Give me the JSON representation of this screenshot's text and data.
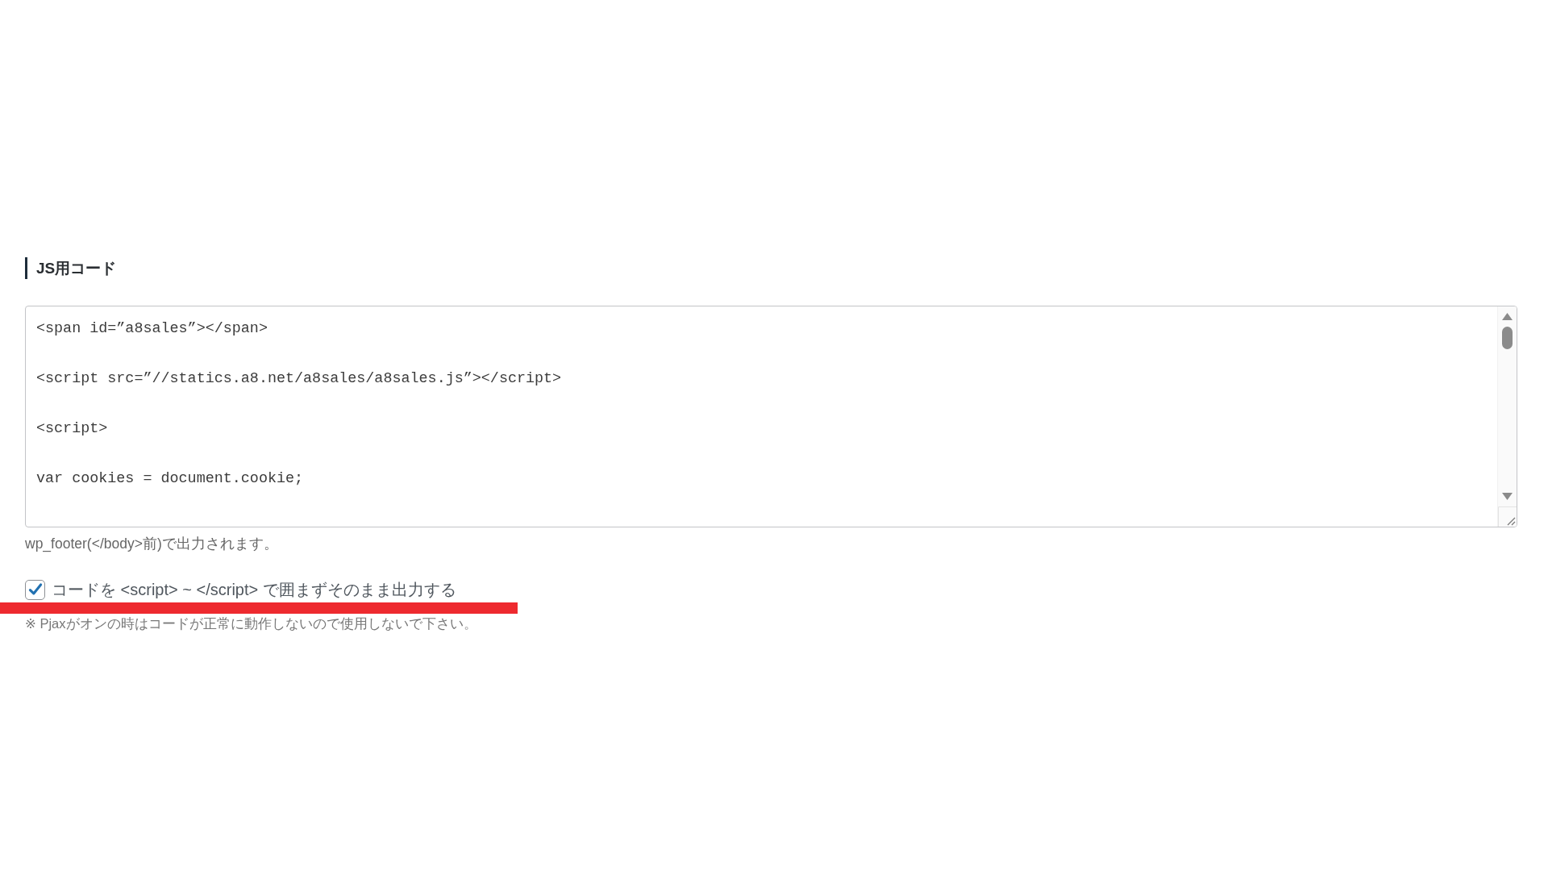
{
  "section": {
    "title": "JS用コード"
  },
  "code_field": {
    "lines": [
      "<span id=”a8sales”></span>",
      "<script src=”//statics.a8.net/a8sales/a8sales.js”></script>",
      "<script>",
      "var cookies = document.cookie;"
    ]
  },
  "help_text": "wp_footer(</body>前)で出力されます。",
  "option": {
    "label": "コードを <script> ~ </script> で囲まずそのまま出力する",
    "checked": true
  },
  "note": "※ Pjaxがオンの時はコードが正常に動作しないので使用しないで下さい。"
}
